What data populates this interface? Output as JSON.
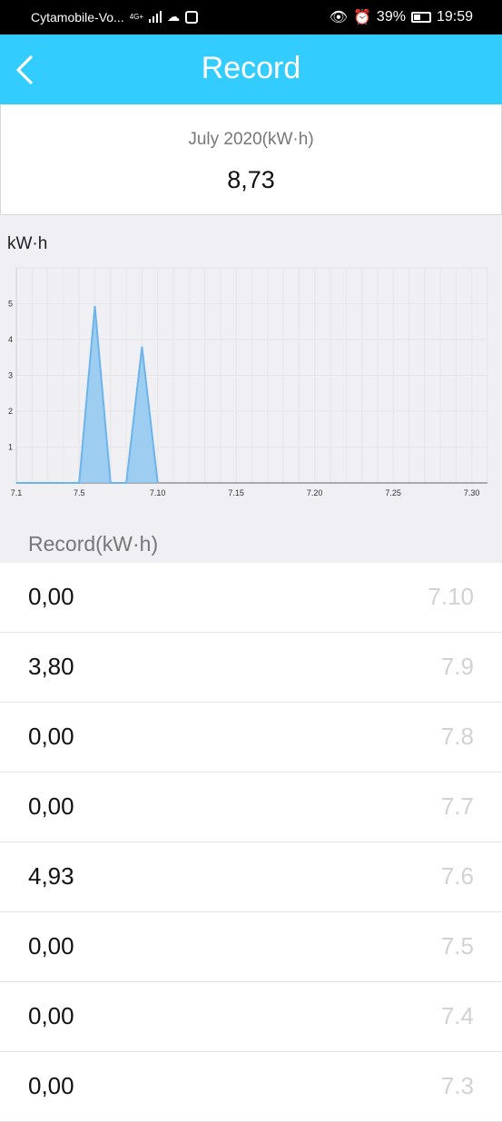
{
  "status": {
    "carrier": "Cytamobile-Vo...",
    "network": "4G+",
    "battery": "39%",
    "time": "19:59"
  },
  "nav": {
    "title": "Record",
    "back_icon": "chevron-left-icon",
    "accent": "#33ccff"
  },
  "summary": {
    "month_label": "July 2020(kW·h)",
    "total": "8,73"
  },
  "chart_unit": "kW·h",
  "chart_data": {
    "type": "area",
    "x": [
      1,
      2,
      3,
      4,
      5,
      6,
      7,
      8,
      9,
      10,
      11,
      12,
      13,
      14,
      15,
      16,
      17,
      18,
      19,
      20,
      21,
      22,
      23,
      24,
      25,
      26,
      27,
      28,
      29,
      30,
      31
    ],
    "x_tick_values": [
      1,
      5,
      10,
      15,
      20,
      25,
      30
    ],
    "x_tick_labels": [
      "7.1",
      "7.5",
      "7.10",
      "7.15",
      "7.20",
      "7.25",
      "7.30"
    ],
    "series": [
      {
        "values": [
          0,
          0,
          0,
          0,
          0,
          4.93,
          0,
          0,
          3.8,
          0,
          null,
          null,
          null,
          null,
          null,
          null,
          null,
          null,
          null,
          null,
          null,
          null,
          null,
          null,
          null,
          null,
          null,
          null,
          null,
          null,
          null
        ],
        "color": "#8ec8f0",
        "line_color": "#6cb4ea"
      }
    ],
    "y_ticks": [
      1,
      2,
      3,
      4,
      5
    ],
    "ylim": [
      0,
      6
    ],
    "xlim": [
      1,
      31
    ],
    "ylabel": "kW·h",
    "grid": true
  },
  "list": {
    "title": "Record(kW·h)",
    "rows": [
      {
        "value": "0,00",
        "date": "7.10"
      },
      {
        "value": "3,80",
        "date": "7.9"
      },
      {
        "value": "0,00",
        "date": "7.8"
      },
      {
        "value": "0,00",
        "date": "7.7"
      },
      {
        "value": "4,93",
        "date": "7.6"
      },
      {
        "value": "0,00",
        "date": "7.5"
      },
      {
        "value": "0,00",
        "date": "7.4"
      },
      {
        "value": "0,00",
        "date": "7.3"
      }
    ]
  }
}
